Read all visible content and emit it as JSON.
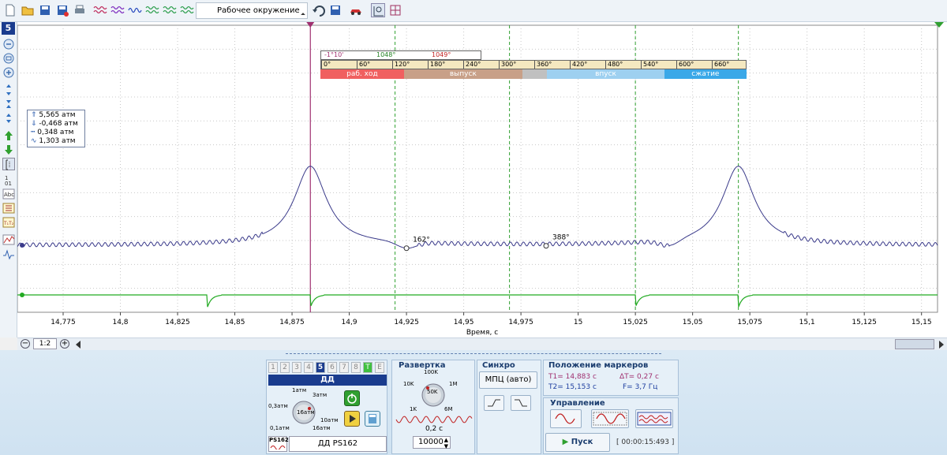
{
  "toolbar": {
    "environment_label": "Рабочее окружение",
    "icons": [
      "new-file-icon",
      "open-folder-icon",
      "save-icon",
      "save-as-icon",
      "print-icon",
      "waveform-icon",
      "waveform-2-icon",
      "waveform-3-icon",
      "waveform-4-icon",
      "waveform-5-icon",
      "undo-icon",
      "save-env-icon",
      "car-icon",
      "grid-icon",
      "crosshair-icon"
    ]
  },
  "sidebar": {
    "channel_number": "5",
    "icons": [
      "zoom-in-icon",
      "zoom-fit-icon",
      "zoom-out-icon",
      "expand-icon",
      "compress-icon",
      "shrink-icon",
      "arrow-up-icon",
      "arrow-down-icon",
      "cursor-icon",
      "counter-icon",
      "text-icon",
      "table-icon",
      "marker-icon",
      "chart-icon",
      "signal-icon"
    ]
  },
  "chart_data": {
    "type": "line",
    "xlabel": "Время, с",
    "x_ticks": [
      "14,775",
      "14,8",
      "14,825",
      "14,85",
      "14,875",
      "14,9",
      "14,925",
      "14,95",
      "14,975",
      "15",
      "15,025",
      "15,05",
      "15,075",
      "15,1",
      "15,125",
      "15,15"
    ],
    "xlim": [
      14.755,
      15.157
    ],
    "stats": [
      {
        "icon": "max-icon",
        "value": "5,565 атм"
      },
      {
        "icon": "min-icon",
        "value": "-0,468 атм"
      },
      {
        "icon": "avg-icon",
        "value": "0,348 атм"
      },
      {
        "icon": "rms-icon",
        "value": "1,303 атм"
      }
    ],
    "point_labels": [
      {
        "x": 14.925,
        "text": "162°"
      },
      {
        "x": 14.986,
        "text": "388°"
      }
    ],
    "markers": {
      "t1": 14.883,
      "t2": 15.153
    },
    "pressure_series": {
      "name": "ДД",
      "color": "#3a3a8a",
      "baseline": 0.0,
      "peaks": [
        14.883,
        15.07
      ],
      "dips": [
        14.925,
        15.04
      ],
      "ripple_ranges": [
        [
          14.755,
          14.862
        ],
        [
          14.93,
          15.04
        ],
        [
          15.09,
          15.157
        ]
      ]
    },
    "sync_series": {
      "color": "#22aa22",
      "pulses": [
        14.838,
        14.883,
        15.025,
        15.07
      ]
    }
  },
  "phase_ruler": {
    "cursor_label": "-1°10'",
    "green_label": "1048°",
    "red_label": "1049°",
    "ticks": [
      "0°",
      "60°",
      "120°",
      "180°",
      "240°",
      "300°",
      "360°",
      "420°",
      "480°",
      "540°",
      "600°",
      "660°"
    ],
    "phases": [
      {
        "label": "раб. ход",
        "color": "#f06060",
        "span": [
          0,
          0.196
        ]
      },
      {
        "label": "выпуск",
        "color": "#c8a088",
        "span": [
          0.196,
          0.474
        ]
      },
      {
        "label": "",
        "color": "#c0c0c0",
        "span": [
          0.474,
          0.532
        ]
      },
      {
        "label": "впуск",
        "color": "#9ed0f0",
        "span": [
          0.532,
          0.807
        ]
      },
      {
        "label": "сжатие",
        "color": "#3aa8e8",
        "span": [
          0.807,
          1.0
        ]
      }
    ]
  },
  "scrollbar": {
    "zoom_label": "1:2"
  },
  "channel_panel": {
    "tabs": [
      "1",
      "2",
      "3",
      "4",
      "5",
      "6",
      "7",
      "8",
      "T",
      "E"
    ],
    "active_tab": "5",
    "channel_name": "ДД",
    "range_labels": [
      "1атм",
      "3атм",
      "0,3атм",
      "16атм",
      "10атм",
      "0,1атм",
      "16атм"
    ],
    "sensor_tag": "PS162",
    "sensor_name": "ДД PS162"
  },
  "sweep_panel": {
    "title": "Развертка",
    "knob_labels": [
      "100K",
      "10K",
      "50K",
      "1M",
      "1K",
      "6M"
    ],
    "time_value": "0,2 с",
    "points_value": "10000"
  },
  "sync_panel": {
    "title": "Синхро",
    "mode_label": "МПЦ (авто)"
  },
  "markers_panel": {
    "title": "Положение маркеров",
    "t1": "T1= 14,883 с",
    "dt": "ΔT= 0,27 с",
    "t2": "T2= 15,153 с",
    "freq": "F= 3,7 Гц"
  },
  "control_panel": {
    "title": "Управление",
    "start_label": "Пуск",
    "timer": "[ 00:00:15:493 ]"
  }
}
